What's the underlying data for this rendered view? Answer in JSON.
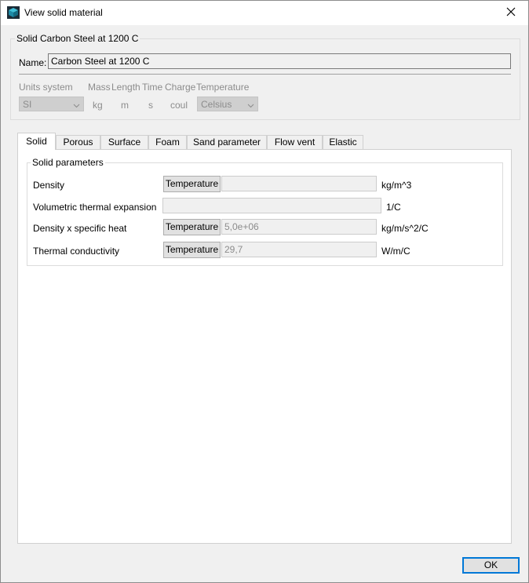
{
  "window": {
    "title": "View solid material"
  },
  "material_group": {
    "legend": "Solid Carbon Steel at 1200 C",
    "name_label": "Name:",
    "name_value": "Carbon Steel at 1200 C"
  },
  "units": {
    "units_system_label": "Units system",
    "units_system_value": "SI",
    "mass_label": "Mass",
    "mass_value": "kg",
    "length_label": "Length",
    "length_value": "m",
    "time_label": "Time",
    "time_value": "s",
    "charge_label": "Charge",
    "charge_value": "coul",
    "temperature_label": "Temperature",
    "temperature_value": "Celsius"
  },
  "tabs": [
    {
      "label": "Solid",
      "active": true
    },
    {
      "label": "Porous"
    },
    {
      "label": "Surface"
    },
    {
      "label": "Foam"
    },
    {
      "label": "Sand parameter"
    },
    {
      "label": "Flow vent"
    },
    {
      "label": "Elastic"
    }
  ],
  "solid_parameters": {
    "legend": "Solid parameters",
    "temperature_button_label": "Temperature",
    "rows": [
      {
        "label": "Density",
        "value": "",
        "unit": "kg/m^3"
      },
      {
        "label": "Volumetric thermal expansion",
        "value": "",
        "unit": "1/C"
      },
      {
        "label": "Density x specific heat",
        "value": "5,0e+06",
        "unit": "kg/m/s^2/C"
      },
      {
        "label": "Thermal conductivity",
        "value": "29,7",
        "unit": "W/m/C"
      }
    ]
  },
  "footer": {
    "ok_label": "OK"
  }
}
